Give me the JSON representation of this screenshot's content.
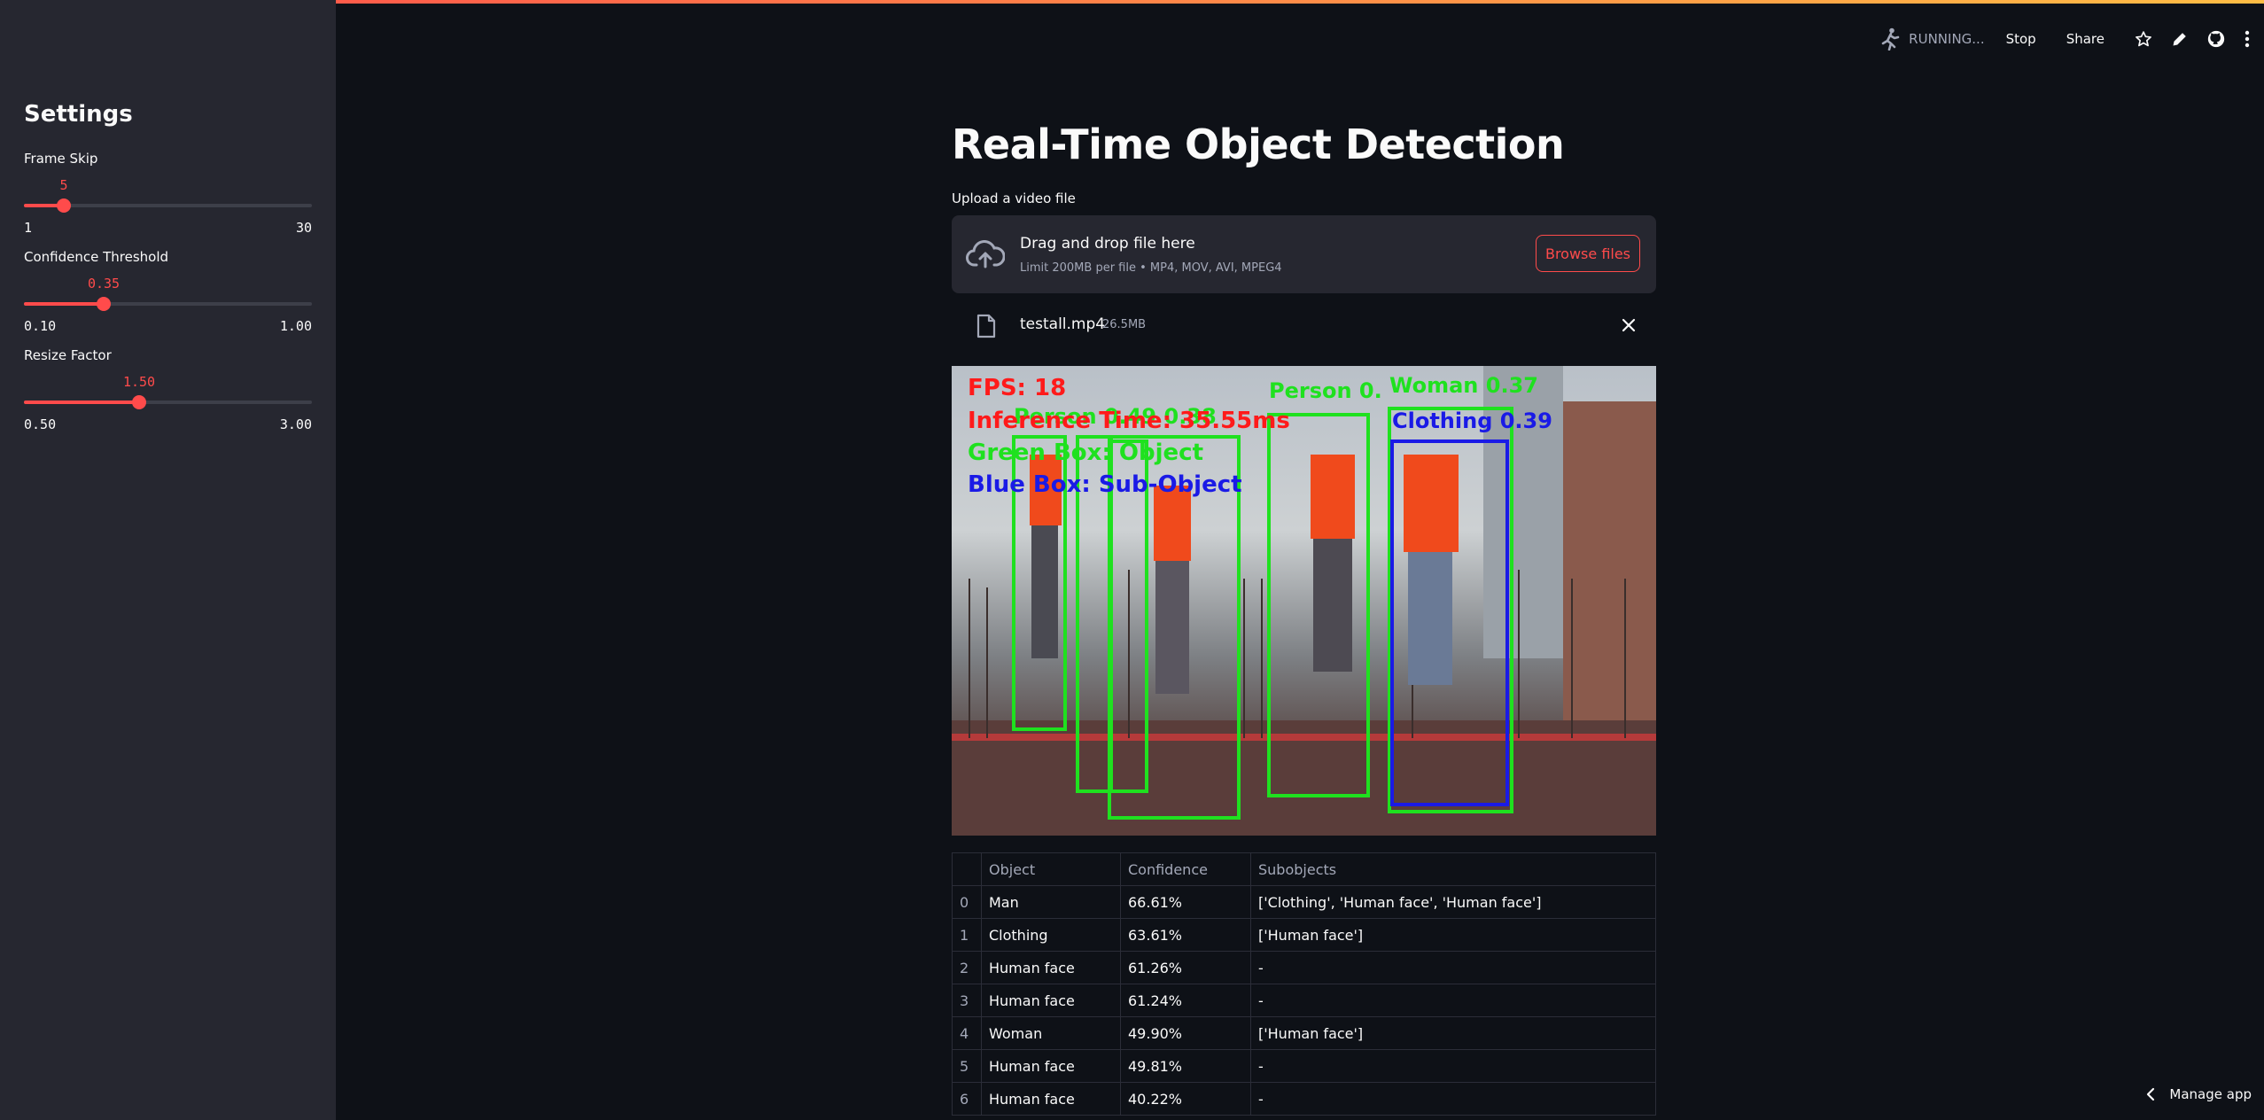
{
  "toolbar": {
    "status": "RUNNING...",
    "stop": "Stop",
    "share": "Share"
  },
  "sidebar": {
    "title": "Settings",
    "sliders": [
      {
        "label": "Frame Skip",
        "value": "5",
        "min": "1",
        "max": "30"
      },
      {
        "label": "Confidence Threshold",
        "value": "0.35",
        "min": "0.10",
        "max": "1.00"
      },
      {
        "label": "Resize Factor",
        "value": "1.50",
        "min": "0.50",
        "max": "3.00"
      }
    ]
  },
  "main": {
    "title": "Real-Time Object Detection",
    "upload_label": "Upload a video file",
    "dropzone": {
      "main": "Drag and drop file here",
      "sub": "Limit 200MB per file • MP4, MOV, AVI, MPEG4",
      "browse": "Browse files"
    },
    "file": {
      "name": "testall.mp4",
      "size": "26.5MB"
    },
    "video_overlay": {
      "fps": "FPS: 18",
      "inference": "Inference Time: 35.55ms",
      "green_legend": "Green Box: Object",
      "blue_legend": "Blue Box: Sub-Object",
      "label_person_a": "Person 0.49 0.38",
      "label_person_b": "Person 0.",
      "label_woman": "Woman 0.37",
      "label_clothing": "Clothing 0.39"
    },
    "table": {
      "headers": [
        "",
        "Object",
        "Confidence",
        "Subobjects"
      ],
      "rows": [
        {
          "idx": "0",
          "object": "Man",
          "confidence": "66.61%",
          "subobjects": "['Clothing', 'Human face', 'Human face']"
        },
        {
          "idx": "1",
          "object": "Clothing",
          "confidence": "63.61%",
          "subobjects": "['Human face']"
        },
        {
          "idx": "2",
          "object": "Human face",
          "confidence": "61.26%",
          "subobjects": "-"
        },
        {
          "idx": "3",
          "object": "Human face",
          "confidence": "61.24%",
          "subobjects": "-"
        },
        {
          "idx": "4",
          "object": "Woman",
          "confidence": "49.90%",
          "subobjects": "['Human face']"
        },
        {
          "idx": "5",
          "object": "Human face",
          "confidence": "49.81%",
          "subobjects": "-"
        },
        {
          "idx": "6",
          "object": "Human face",
          "confidence": "40.22%",
          "subobjects": "-"
        }
      ]
    }
  },
  "footer": {
    "manage": "Manage app"
  }
}
